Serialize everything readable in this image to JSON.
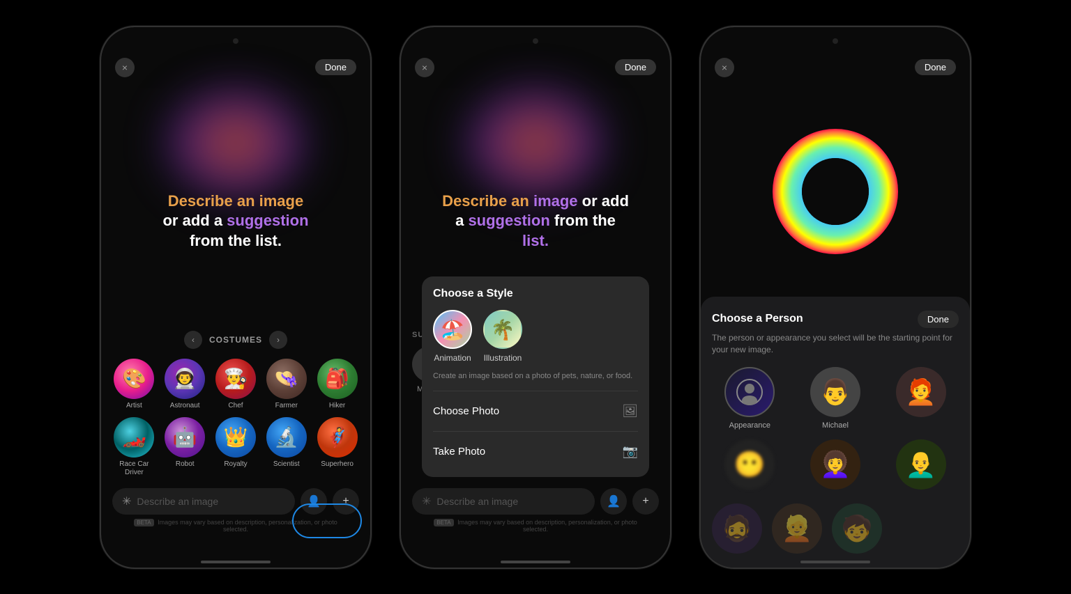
{
  "phones": [
    {
      "id": "phone1",
      "top_bar": {
        "close_label": "×",
        "done_label": "Done"
      },
      "main_prompt": {
        "line1": "Describe an image",
        "line2": "or add a",
        "highlight1": "suggestion",
        "line3": "from the list."
      },
      "section_title": "COSTUMES",
      "costumes_row1": [
        {
          "label": "Artist",
          "emoji": "🎨",
          "color": "av-pink"
        },
        {
          "label": "Astronaut",
          "emoji": "👨‍🚀",
          "color": "av-purple"
        },
        {
          "label": "Chef",
          "emoji": "👨‍🍳",
          "color": "av-red"
        },
        {
          "label": "Farmer",
          "emoji": "👒",
          "color": "av-brown"
        },
        {
          "label": "Hiker",
          "emoji": "🎒",
          "color": "av-green"
        }
      ],
      "costumes_row2": [
        {
          "label": "Race Car\nDriver",
          "emoji": "🏎️",
          "color": "av-cyan"
        },
        {
          "label": "Robot",
          "emoji": "🤖",
          "color": "av-violet"
        },
        {
          "label": "Royalty",
          "emoji": "👑",
          "color": "av-blue"
        },
        {
          "label": "Scientist",
          "emoji": "🔬",
          "color": "av-blue"
        },
        {
          "label": "Superhero",
          "emoji": "🦸",
          "color": "av-orange-red"
        }
      ],
      "input_placeholder": "Describe an image",
      "beta_text": "BETA Images may vary based on description, personalization, or photo selected."
    },
    {
      "id": "phone2",
      "top_bar": {
        "close_label": "×",
        "done_label": "Done"
      },
      "main_prompt": {
        "text": "Describe an image or add a suggestion from the list."
      },
      "suggestions_label": "SUGGESTIONS",
      "suggestions": [
        {
          "name": "Michael",
          "emoji": "👨"
        }
      ],
      "dropdown": {
        "title": "Choose a Style",
        "options": [
          {
            "name": "Animation",
            "emoji": "🏖️"
          },
          {
            "name": "Illustration",
            "emoji": "🌴"
          }
        ],
        "description": "Create an image based on a photo of pets, nature, or food.",
        "actions": [
          {
            "label": "Choose Photo",
            "icon": "🖼"
          },
          {
            "label": "Take Photo",
            "icon": "📷"
          }
        ]
      },
      "input_placeholder": "Describe an image",
      "beta_text": "BETA Images may vary based on description, personalization, or photo selected."
    },
    {
      "id": "phone3",
      "top_bar": {
        "close_label": "×",
        "done_label": "Done"
      },
      "panel": {
        "title": "Choose a Person",
        "done_label": "Done",
        "subtitle": "The person or appearance you select will be the starting point for your new image.",
        "people": [
          {
            "label": "Appearance",
            "type": "appearance"
          },
          {
            "label": "Michael",
            "emoji": "👨",
            "type": "person"
          },
          {
            "label": "",
            "emoji": "🧑‍🦰",
            "type": "person"
          },
          {
            "label": "",
            "emoji": "🧒",
            "type": "person"
          },
          {
            "label": "",
            "emoji": "👩‍🦱",
            "type": "person"
          },
          {
            "label": "",
            "emoji": "👨‍🦲",
            "type": "person"
          }
        ]
      }
    }
  ]
}
